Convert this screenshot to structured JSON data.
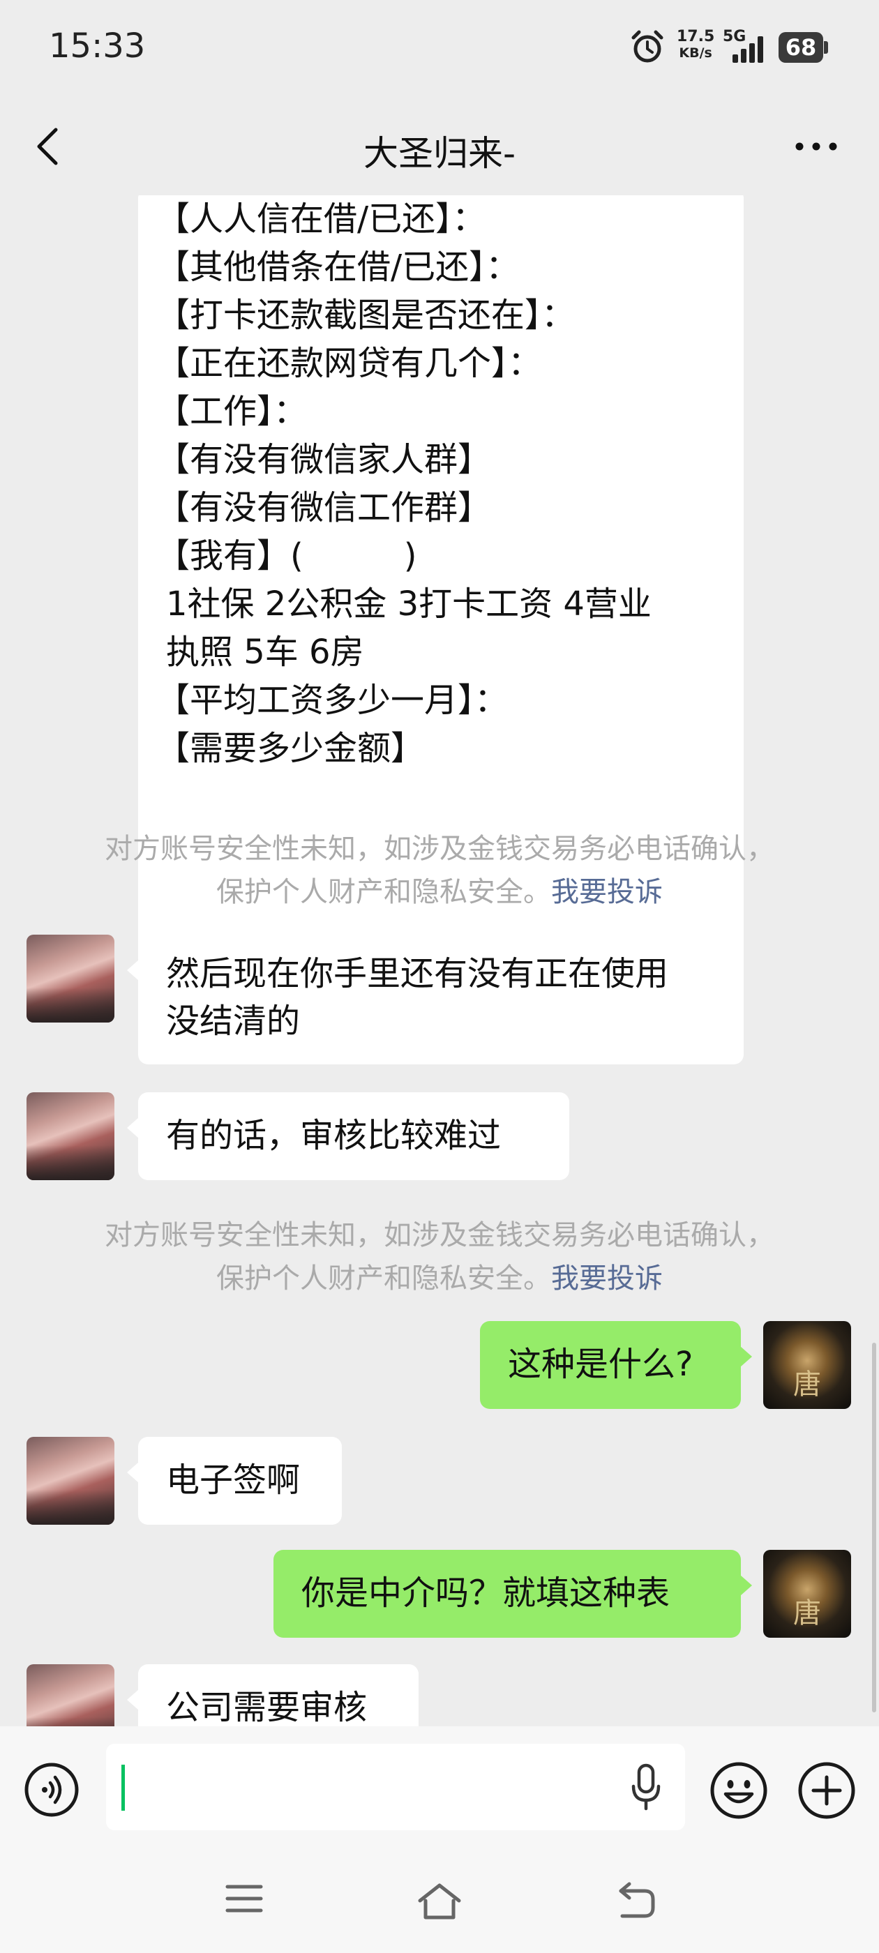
{
  "status_bar": {
    "time": "15:33",
    "net_speed_value": "17.5",
    "net_speed_unit": "KB/s",
    "network": "5G",
    "battery": "68",
    "icons": [
      "alarm-icon",
      "signal-icon",
      "battery-icon"
    ]
  },
  "header": {
    "title": "大圣归来-"
  },
  "messages": {
    "form": {
      "lines": [
        "【人人信在借/已还】：",
        "【其他借条在借/已还】：",
        "【打卡还款截图是否还在】：",
        "【正在还款网贷有几个】：",
        "【工作】：",
        "【有没有微信家人群】",
        "【有没有微信工作群】",
        "【我有】(　　　)",
        "1社保 2公积金 3打卡工资 4营业",
        "执照 5车 6房",
        "【平均工资多少一月】：",
        "【需要多少金额】"
      ]
    },
    "notice1": {
      "line1": "对方账号安全性未知，如涉及金钱交易务必电话确认，",
      "line2": "保护个人财产和隐私安全。",
      "link": "我要投诉"
    },
    "in1": {
      "line1": "然后现在你手里还有没有正在使用",
      "line2": "没结清的"
    },
    "in2": {
      "text": "有的话，审核比较难过"
    },
    "notice2": {
      "line1": "对方账号安全性未知，如涉及金钱交易务必电话确认，",
      "line2": "保护个人财产和隐私安全。",
      "link": "我要投诉"
    },
    "out1": {
      "text": "这种是什么?"
    },
    "in3": {
      "text": "电子签啊"
    },
    "out2": {
      "text": "你是中介吗？就填这种表"
    },
    "in4": {
      "text": "公司需要审核"
    },
    "my_avatar_char": "唐"
  },
  "input_bar": {
    "value": "",
    "icons": [
      "voice-icon",
      "microphone-icon",
      "emoji-icon",
      "plus-icon"
    ]
  },
  "nav_bar": {
    "icons": [
      "menu-icon",
      "home-icon",
      "back-icon"
    ]
  },
  "colors": {
    "background": "#ededed",
    "incoming_bubble": "#ffffff",
    "outgoing_bubble": "#95ec69",
    "link": "#576b95",
    "notice_text": "#aaaaaa",
    "caret": "#07c160"
  }
}
